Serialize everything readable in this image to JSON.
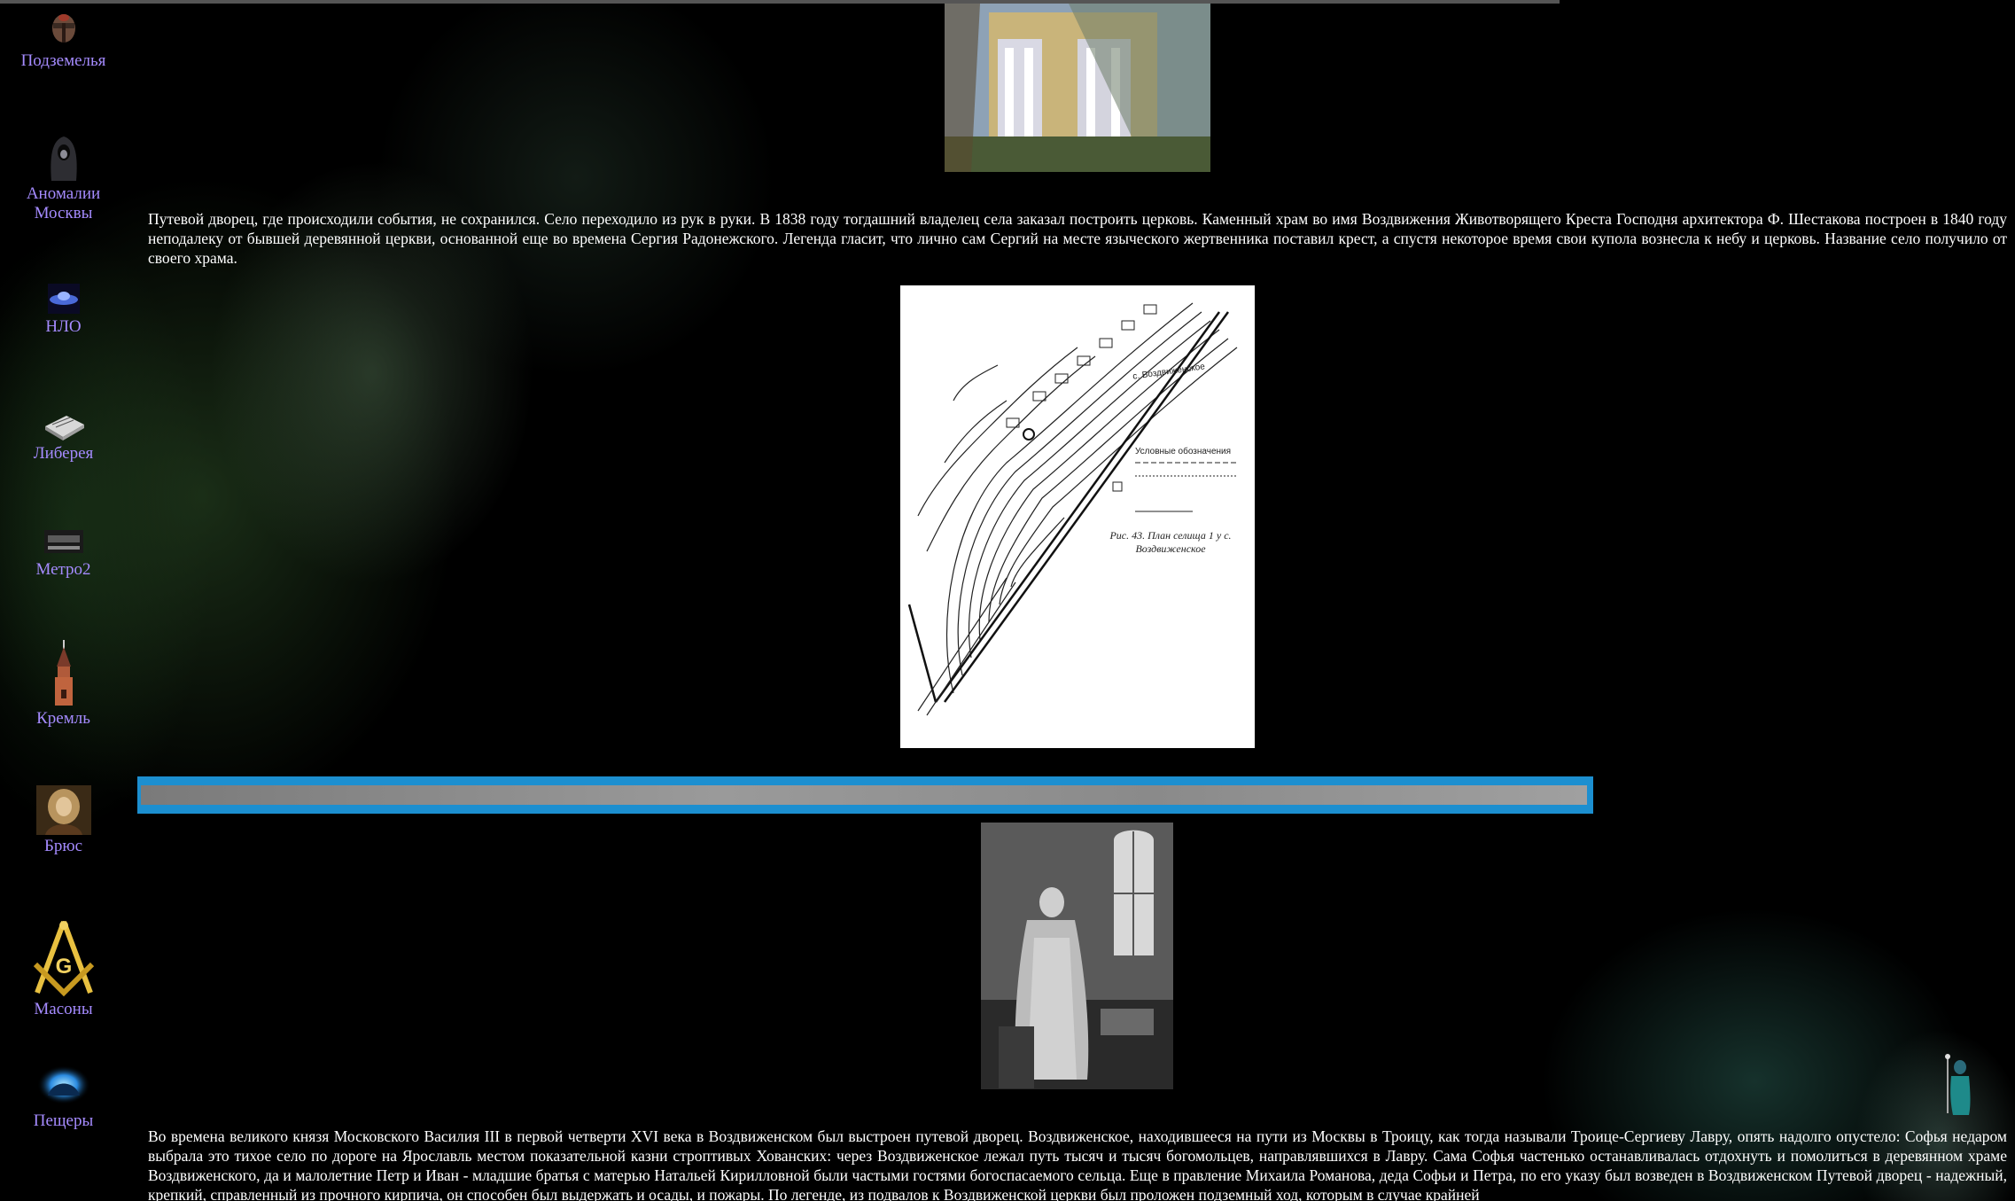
{
  "sidebar": {
    "items": [
      {
        "label": "Подземелья",
        "icon": "helmet-icon"
      },
      {
        "label": "Аномалии Москвы",
        "label_lines": [
          "Аномалии",
          "Москвы"
        ],
        "icon": "hooded-figure-icon"
      },
      {
        "label": "НЛО",
        "icon": "ufo-icon"
      },
      {
        "label": "Либерея",
        "icon": "book-icon"
      },
      {
        "label": "Метро2",
        "icon": "metro-train-icon"
      },
      {
        "label": "Кремль",
        "icon": "kremlin-tower-icon"
      },
      {
        "label": "Брюс",
        "icon": "bruce-portrait-icon"
      },
      {
        "label": "Масоны",
        "icon": "masonic-compass-icon"
      },
      {
        "label": "Пещеры",
        "icon": "cave-glow-icon"
      }
    ],
    "label_color": "#a58bff"
  },
  "main": {
    "paragraph1": "Путевой дворец, где происходили события, не сохранился. Село переходило из рук в руки. В 1838 году тогдашний владелец села заказал построить церковь. Каменный храм во имя Воздвижения Животворящего Креста Господня архитектора Ф. Шестакова построен в 1840 году неподалеку от бывшей деревянной церкви, основанной еще во времена Сергия Радонежского. Легенда гласит, что лично сам Сергий на месте языческого жертвенника поставил крест, а спустя некоторое время свои купола вознесла к небу и церковь. Название село получило от своего храма.",
    "map": {
      "caption": "Рис. 43. План селища 1 у с. Воздвиженское",
      "legend_title": "Условные обозначения",
      "village_label": "с. Воздвиженское"
    },
    "paragraph2": "Во времена великого князя Московского Василия III в первой четверти XVI века в Воздвиженском был выстроен путевой дворец. Воздвиженское, находившееся на пути из Москвы в Троицу, как тогда называли Троице-Сергиеву Лавру, опять надолго опустело: Софья недаром выбрала это тихое село по дороге на Ярославль местом показательной казни строптивых Хованских: через Воздвиженское лежал путь тысяч и тысяч богомольцев, направлявшихся в Лавру. Сама Софья частенько останавливалась отдохнуть и помолиться в деревянном храме Воздвиженского, да и малолетние Петр и Иван - младшие братья с матерью Натальей Кирилловной были частыми гостями богоспасаемого сельца. Еще в правление Михаила Романова, деда Софьи и Петра, по его указу был возведен в Воздвиженском Путевой дворец - надежный, крепкий, справленный из прочного кирпича, он способен был выдержать и осады, и пожары. По легенде, из подвалов к Воздвиженской церкви был проложен подземный ход, которым в случае крайней"
  },
  "colors": {
    "divider_border": "#1c8fd0",
    "divider_fill": "#8a8a8a",
    "background": "#000000"
  }
}
